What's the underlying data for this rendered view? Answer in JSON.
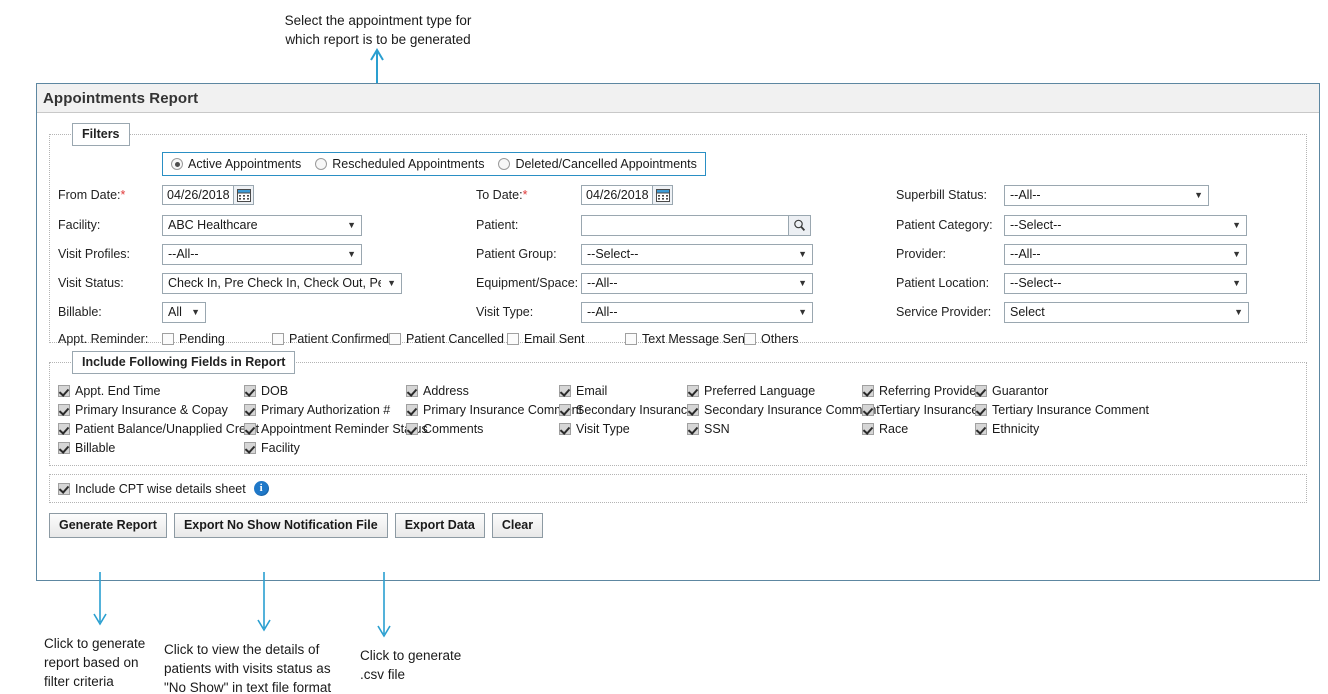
{
  "annotations": {
    "top": "Select the appointment type for\nwhich report is to be generated",
    "bottom_left": "Click to generate\nreport based on\nfilter criteria",
    "bottom_mid": "Click to view the details of\npatients with visits status as\n\"No Show\" in text file format",
    "bottom_right": "Click to generate\n.csv file",
    "arrow_color": "#2a9fd0"
  },
  "report": {
    "title": "Appointments Report"
  },
  "filters": {
    "legend": "Filters",
    "appointment_types": [
      {
        "label": "Active Appointments",
        "selected": true
      },
      {
        "label": "Rescheduled Appointments",
        "selected": false
      },
      {
        "label": "Deleted/Cancelled Appointments",
        "selected": false
      }
    ],
    "from_date": {
      "label": "From Date:",
      "required": true,
      "value": "04/26/2018",
      "icon": "calendar-icon"
    },
    "to_date": {
      "label": "To Date:",
      "required": true,
      "value": "04/26/2018",
      "icon": "calendar-icon"
    },
    "superbill_status": {
      "label": "Superbill Status:",
      "value": "--All--"
    },
    "facility": {
      "label": "Facility:",
      "value": "ABC Healthcare"
    },
    "patient": {
      "label": "Patient:",
      "value": "",
      "placeholder": "",
      "icon": "search-icon"
    },
    "patient_category": {
      "label": "Patient Category:",
      "value": "--Select--"
    },
    "visit_profiles": {
      "label": "Visit Profiles:",
      "value": "--All--"
    },
    "patient_group": {
      "label": "Patient Group:",
      "value": "--Select--"
    },
    "provider": {
      "label": "Provider:",
      "value": "--All--"
    },
    "visit_status": {
      "label": "Visit Status:",
      "value": "Check In, Pre Check In, Check Out, Per"
    },
    "equipment_space": {
      "label": "Equipment/Space:",
      "value": "--All--"
    },
    "patient_location": {
      "label": "Patient Location:",
      "value": "--Select--"
    },
    "billable": {
      "label": "Billable:",
      "value": "All"
    },
    "visit_type": {
      "label": "Visit Type:",
      "value": "--All--"
    },
    "service_provider": {
      "label": "Service Provider:",
      "value": "Select"
    },
    "appt_reminder": {
      "label": "Appt. Reminder:",
      "options": [
        {
          "label": "Pending",
          "checked": false
        },
        {
          "label": "Patient Confirmed",
          "checked": false
        },
        {
          "label": "Patient Cancelled",
          "checked": false
        },
        {
          "label": "Email Sent",
          "checked": false
        },
        {
          "label": "Text Message Sent",
          "checked": false
        },
        {
          "label": "Others",
          "checked": false
        }
      ]
    }
  },
  "include_fields": {
    "legend": "Include Following Fields in Report",
    "rows": [
      [
        {
          "label": "Appt. End Time",
          "checked": true
        },
        {
          "label": "DOB",
          "checked": true
        },
        {
          "label": "Address",
          "checked": true
        },
        {
          "label": "Email",
          "checked": true
        },
        {
          "label": "Preferred Language",
          "checked": true
        },
        {
          "label": "Referring Provider",
          "checked": true
        },
        {
          "label": "Guarantor",
          "checked": true
        }
      ],
      [
        {
          "label": "Primary Insurance & Copay",
          "checked": true
        },
        {
          "label": "Primary Authorization #",
          "checked": true
        },
        {
          "label": "Primary Insurance Comment",
          "checked": true
        },
        {
          "label": "Secondary Insurance",
          "checked": true
        },
        {
          "label": "Secondary Insurance Comment",
          "checked": true
        },
        {
          "label": "Tertiary Insurance",
          "checked": true
        },
        {
          "label": "Tertiary Insurance Comment",
          "checked": true
        }
      ],
      [
        {
          "label": "Patient Balance/Unapplied Credit",
          "checked": true
        },
        {
          "label": "Appointment Reminder Status",
          "checked": true
        },
        {
          "label": "Comments",
          "checked": true
        },
        {
          "label": "Visit Type",
          "checked": true
        },
        {
          "label": "SSN",
          "checked": true
        },
        {
          "label": "Race",
          "checked": true
        },
        {
          "label": "Ethnicity",
          "checked": true
        }
      ],
      [
        {
          "label": "Billable",
          "checked": true
        },
        {
          "label": "Facility",
          "checked": true
        }
      ]
    ]
  },
  "cpt": {
    "label": "Include CPT wise details sheet",
    "checked": true,
    "info_icon": "info-icon"
  },
  "buttons": {
    "generate_report": "Generate Report",
    "export_no_show": "Export No Show Notification File",
    "export_data": "Export Data",
    "clear": "Clear"
  }
}
